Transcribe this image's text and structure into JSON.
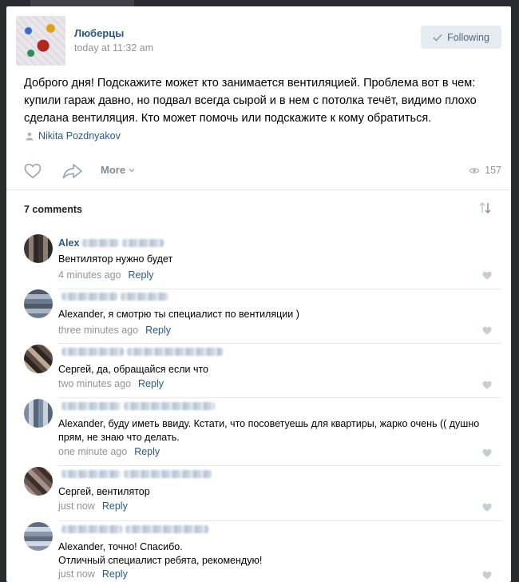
{
  "post": {
    "group_name": "Люберцы",
    "time": "today at 11:32 am",
    "follow_label": "Following",
    "text": "Доброго дня! Подскажите может кто занимается вентиляцией. Проблема вот в чем: купили гараж давно, но подвал всегда сырой и в нем с потолка течёт, видимо плохо сделана вентиляция. Кто может помочь или подскажите к кому обратиться.",
    "author": "Nikita Pozdnyakov",
    "more_label": "More",
    "views": "157"
  },
  "comments_header": {
    "count_label": "7 comments"
  },
  "comments": [
    {
      "name": "Alex",
      "text": "Вентилятор нужно будет",
      "time": "4 minutes ago",
      "reply": "Reply"
    },
    {
      "name": "",
      "text": "Alexander, я смотрю ты специалист по вентиляции )",
      "time": "three minutes ago",
      "reply": "Reply"
    },
    {
      "name": "",
      "text": "Сергей, да, обращайся если что",
      "time": "two minutes ago",
      "reply": "Reply"
    },
    {
      "name": "",
      "text": "Alexander, буду иметь ввиду. Кстати, что посоветуешь для квартиры, жарко очень (( душно прям, не знаю что делать.",
      "time": "one minute ago",
      "reply": "Reply"
    },
    {
      "name": "",
      "text": "Сергей, вентилятор",
      "time": "just now",
      "reply": "Reply"
    },
    {
      "name": "",
      "text": "Alexander, точно! Спасибо.\nОтличный специалист ребята, рекомендую!",
      "time": "just now",
      "reply": "Reply"
    }
  ],
  "colors": {
    "link": "#2a5885",
    "muted": "#939393",
    "button_bg": "#e5ebf1"
  }
}
